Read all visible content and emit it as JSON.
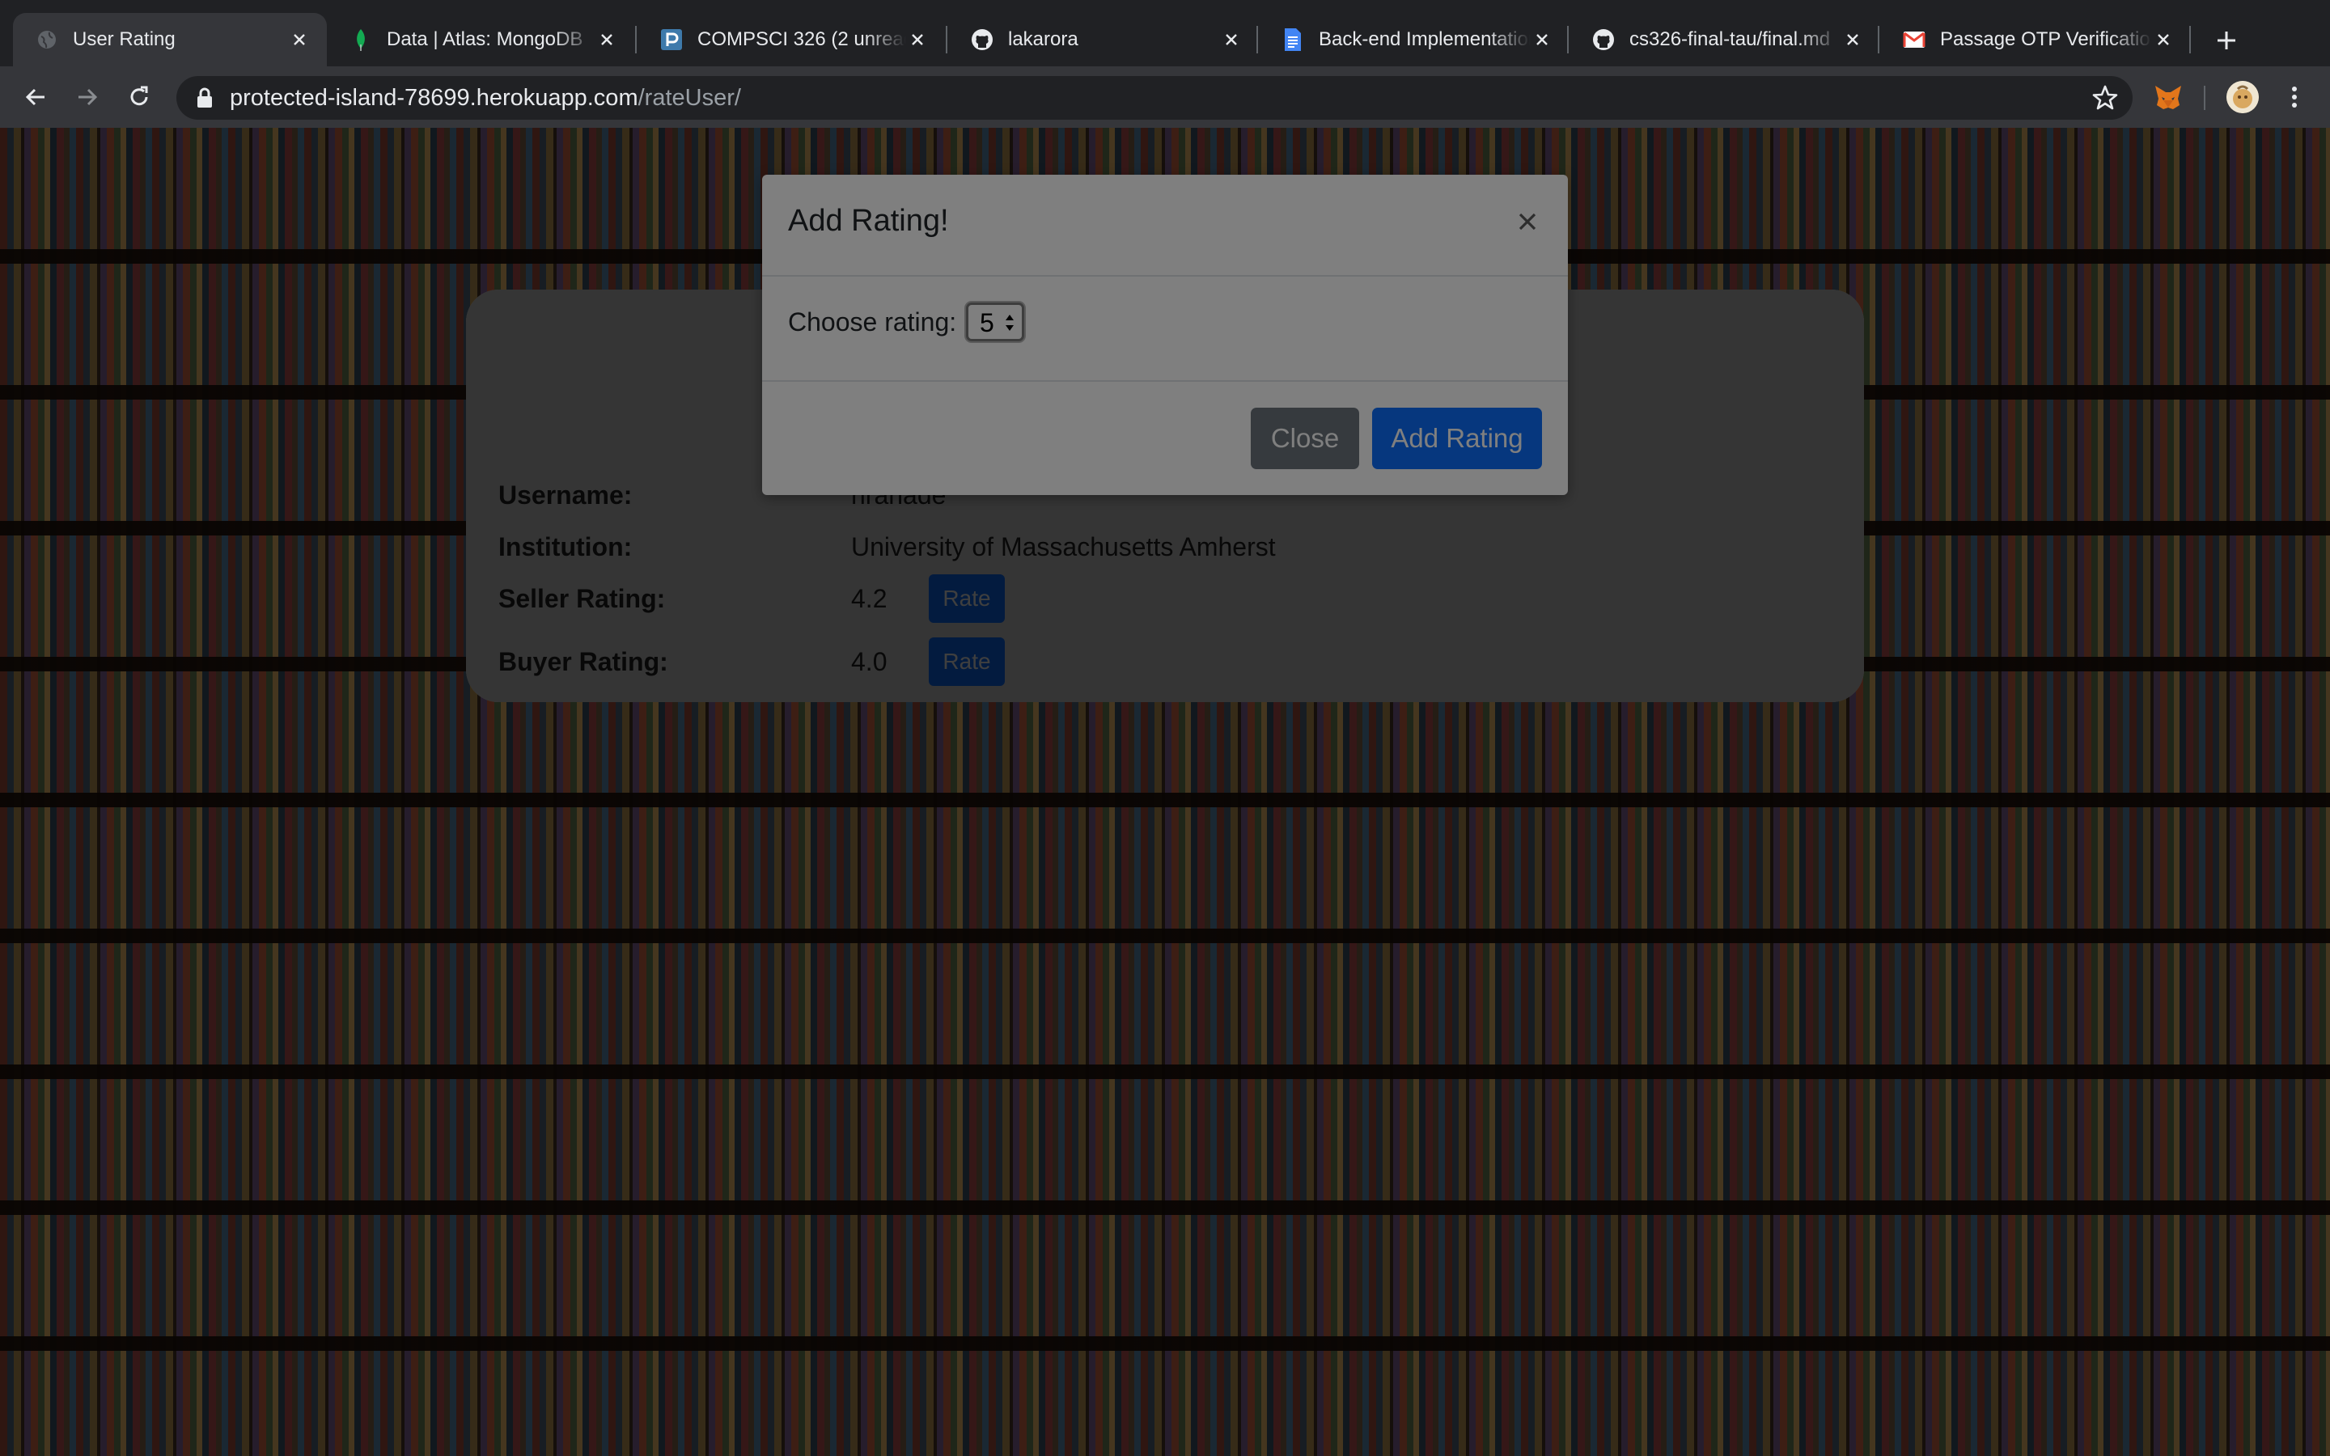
{
  "tabs": [
    {
      "title": "User Rating",
      "icon": "globe-icon"
    },
    {
      "title": "Data | Atlas: MongoDB",
      "icon": "mongodb-leaf-icon"
    },
    {
      "title": "COMPSCI 326 (2 unread)",
      "icon": "piazza-icon"
    },
    {
      "title": "lakarora",
      "icon": "github-icon"
    },
    {
      "title": "Back-end Implementation",
      "icon": "google-docs-icon"
    },
    {
      "title": "cs326-final-tau/final.md",
      "icon": "github-icon"
    },
    {
      "title": "Passage OTP Verification",
      "icon": "gmail-icon"
    }
  ],
  "address": {
    "host": "protected-island-78699.herokuapp.com",
    "path": "/rateUser/"
  },
  "profile": {
    "rows": [
      {
        "label": "Username:",
        "value": "nranade"
      },
      {
        "label": "Institution:",
        "value": "University of Massachusetts Amherst"
      },
      {
        "label": "Seller Rating:",
        "value": "4.2",
        "button": "Rate"
      },
      {
        "label": "Buyer Rating:",
        "value": "4.0",
        "button": "Rate"
      }
    ]
  },
  "modal": {
    "title": "Add Rating!",
    "close_symbol": "×",
    "choose_label": "Choose rating:",
    "selected_rating": "5",
    "close_button": "Close",
    "add_button": "Add Rating"
  },
  "colors": {
    "primary": "#0d6efd",
    "secondary": "#6c757d",
    "chrome_dark": "#202124",
    "chrome_toolbar": "#35363a"
  }
}
